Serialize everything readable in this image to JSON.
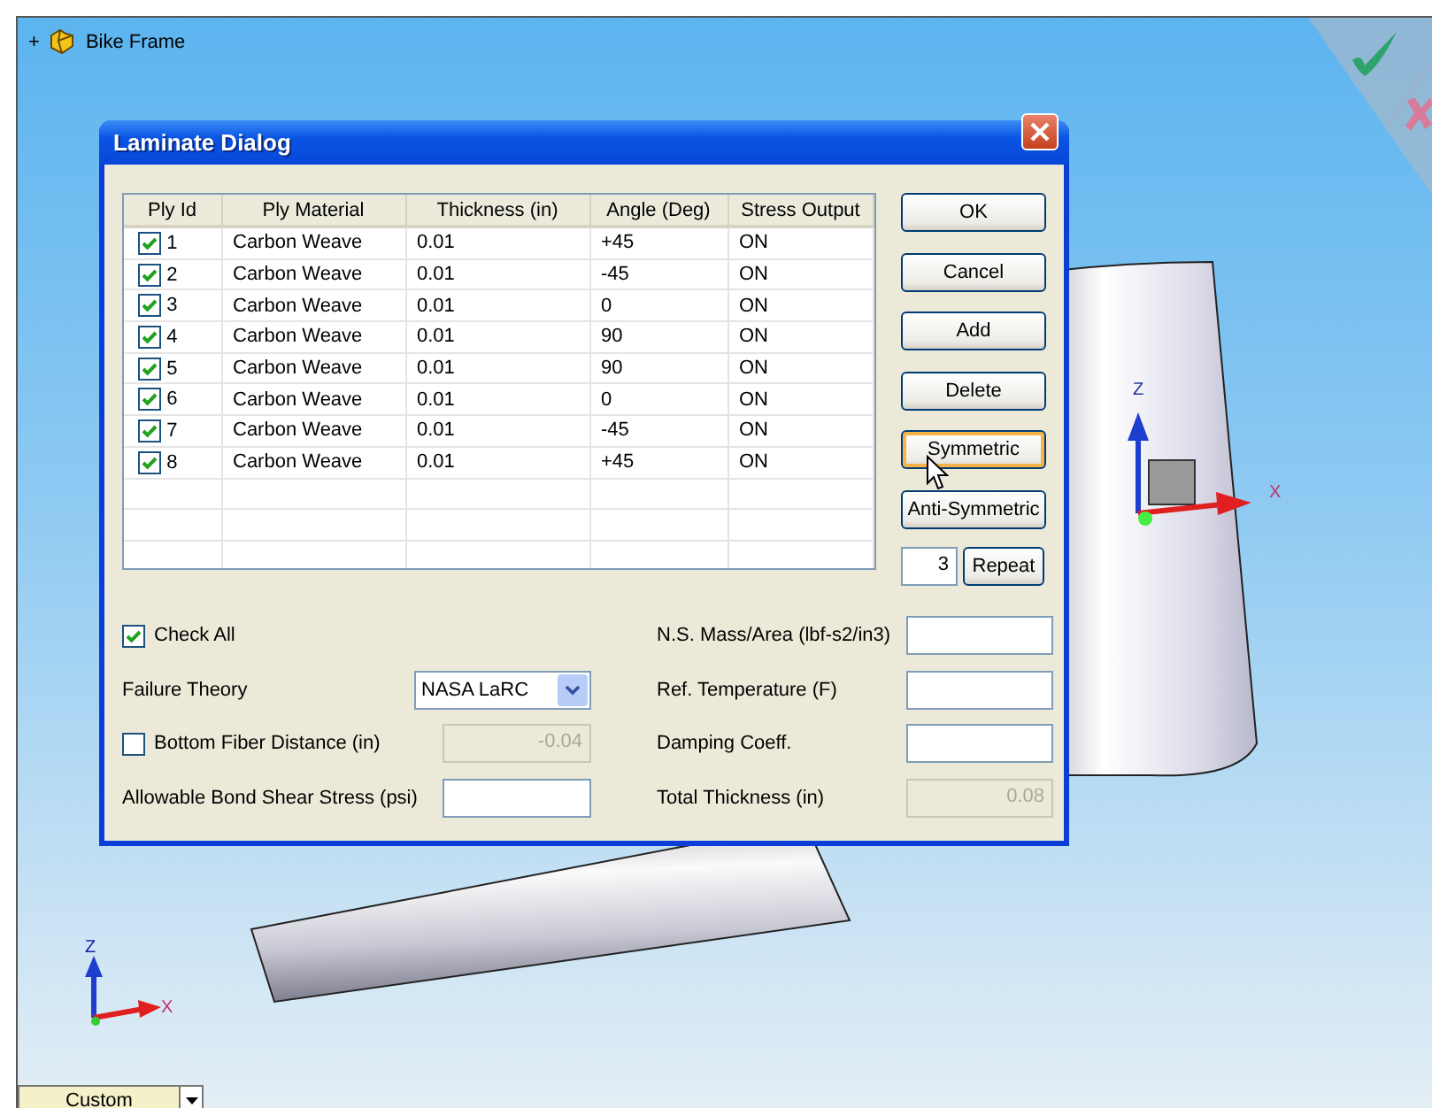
{
  "tree": {
    "expander": "+",
    "label": "Bike Frame"
  },
  "dialog": {
    "title": "Laminate Dialog",
    "table": {
      "columns": [
        "Ply Id",
        "Ply Material",
        "Thickness (in)",
        "Angle (Deg)",
        "Stress Output"
      ],
      "rows": [
        {
          "checked": true,
          "id": "1",
          "material": "Carbon Weave",
          "thickness": "0.01",
          "angle": "+45",
          "stress_output": "ON"
        },
        {
          "checked": true,
          "id": "2",
          "material": "Carbon Weave",
          "thickness": "0.01",
          "angle": "-45",
          "stress_output": "ON"
        },
        {
          "checked": true,
          "id": "3",
          "material": "Carbon Weave",
          "thickness": "0.01",
          "angle": "0",
          "stress_output": "ON"
        },
        {
          "checked": true,
          "id": "4",
          "material": "Carbon Weave",
          "thickness": "0.01",
          "angle": "90",
          "stress_output": "ON"
        },
        {
          "checked": true,
          "id": "5",
          "material": "Carbon Weave",
          "thickness": "0.01",
          "angle": "90",
          "stress_output": "ON"
        },
        {
          "checked": true,
          "id": "6",
          "material": "Carbon Weave",
          "thickness": "0.01",
          "angle": "0",
          "stress_output": "ON"
        },
        {
          "checked": true,
          "id": "7",
          "material": "Carbon Weave",
          "thickness": "0.01",
          "angle": "-45",
          "stress_output": "ON"
        },
        {
          "checked": true,
          "id": "8",
          "material": "Carbon Weave",
          "thickness": "0.01",
          "angle": "+45",
          "stress_output": "ON"
        }
      ]
    },
    "buttons": [
      {
        "label": "OK",
        "hovered": false
      },
      {
        "label": "Cancel",
        "hovered": false
      },
      {
        "label": "Add",
        "hovered": false
      },
      {
        "label": "Delete",
        "hovered": false
      },
      {
        "label": "Symmetric",
        "hovered": true
      },
      {
        "label": "Anti-Symmetric",
        "hovered": false
      }
    ],
    "repeat": {
      "value": "3",
      "label": "Repeat"
    },
    "check_all": {
      "label": "Check All",
      "checked": true
    },
    "failure_theory": {
      "label": "Failure Theory",
      "value": "NASA LaRC"
    },
    "bottom_fiber": {
      "label": "Bottom Fiber Distance (in)",
      "checked": false,
      "value": "-0.04",
      "disabled": true
    },
    "bond_shear": {
      "label": "Allowable Bond Shear Stress (psi)",
      "disabled": false
    },
    "right_fields": [
      {
        "label": "N.S. Mass/Area (lbf-s2/in3)",
        "disabled": false
      },
      {
        "label": "Ref. Temperature (F)",
        "disabled": false
      },
      {
        "label": "Damping Coeff.",
        "disabled": false
      },
      {
        "label": "Total Thickness (in)",
        "value": "0.08",
        "disabled": true
      }
    ]
  },
  "triads": [
    {
      "z": "Z",
      "x": "X",
      "kind": "part"
    },
    {
      "z": "Z",
      "x": "X",
      "kind": "view"
    }
  ],
  "view_dropdown": {
    "value": "Custom"
  }
}
